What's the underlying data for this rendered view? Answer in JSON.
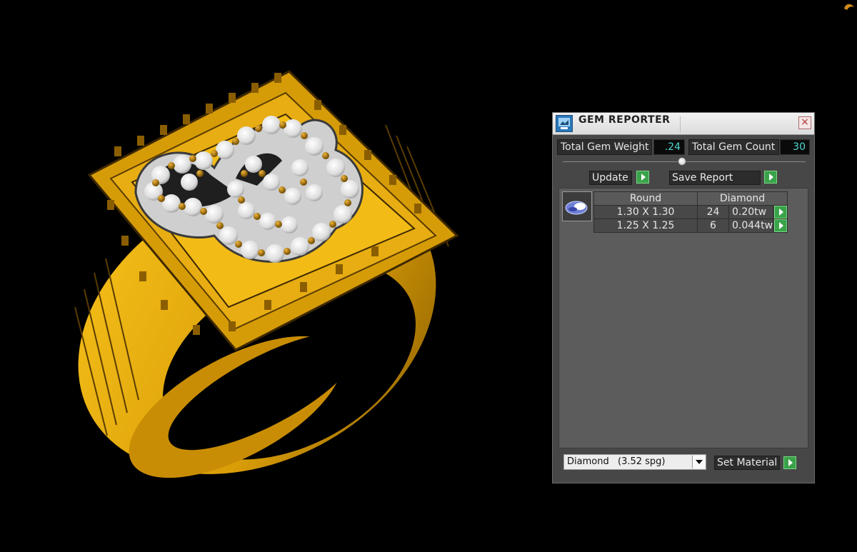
{
  "window": {
    "title": "GEM REPORTER",
    "close_label": "×"
  },
  "summary": {
    "weight_label": "Total Gem Weight",
    "weight_value": ".24",
    "count_label": "Total Gem Count",
    "count_value": "30"
  },
  "actions": {
    "update_label": "Update",
    "save_report_label": "Save Report"
  },
  "gem_group": {
    "icon": "round-gem-icon",
    "shape_header": "Round",
    "material_header": "Diamond",
    "rows": [
      {
        "size": "1.30 X 1.30",
        "count": "24",
        "weight": "0.20tw"
      },
      {
        "size": "1.25 X 1.25",
        "count": "6",
        "weight": "0.044tw"
      }
    ]
  },
  "material": {
    "selected_name": "Diamond",
    "selected_spg": "(3.52 spg)",
    "set_label": "Set Material"
  },
  "colors": {
    "ring_gold": "#e6ad0a",
    "gem_white": "#f0f0f0",
    "panel_bg": "#474747",
    "value_text": "#4fd7d2",
    "go_button": "#3aa34a"
  }
}
